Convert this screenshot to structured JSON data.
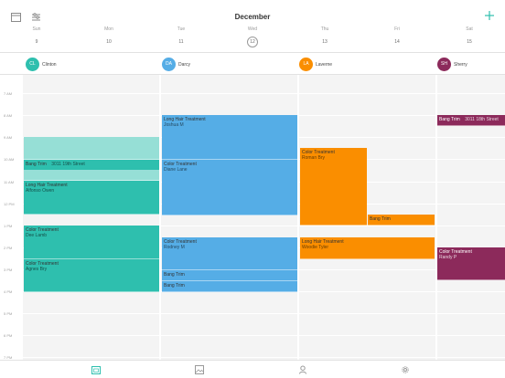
{
  "header": {
    "month": "December",
    "add_icon": "plus-icon",
    "calendar_icon": "calendar-icon",
    "filter_icon": "filter-icon"
  },
  "week": [
    {
      "name": "Sun",
      "num": "9"
    },
    {
      "name": "Mon",
      "num": "10"
    },
    {
      "name": "Tue",
      "num": "11"
    },
    {
      "name": "Wed",
      "num": "12"
    },
    {
      "name": "Thu",
      "num": "13"
    },
    {
      "name": "Fri",
      "num": "14"
    },
    {
      "name": "Sat",
      "num": "15"
    }
  ],
  "today": "12",
  "staff": [
    {
      "initials": "CL",
      "name": "Clinton",
      "color": "#2ebfae"
    },
    {
      "initials": "DA",
      "name": "Darcy",
      "color": "#55ade6"
    },
    {
      "initials": "LA",
      "name": "Laverne",
      "color": "#fa8e00"
    },
    {
      "initials": "SH",
      "name": "Sherry",
      "color": "#8c2a5b"
    }
  ],
  "times": [
    "7 AM",
    "8 AM",
    "9 AM",
    "10 AM",
    "11 AM",
    "12 PM",
    "1 PM",
    "2 PM",
    "3 PM",
    "4 PM",
    "5 PM",
    "6 PM",
    "7 PM"
  ],
  "events": {
    "clinton": [
      {
        "title": "Bang Trim",
        "sub": "3011 19th Street"
      },
      {
        "title": "Long Hair Treatment",
        "sub": "Alfonso Owen"
      },
      {
        "title": "Color Treatment",
        "sub": "Dee Lamb"
      },
      {
        "title": "Color Treatment",
        "sub": "Agnes Bry"
      }
    ],
    "darcy": [
      {
        "title": "Long Hair Treatment",
        "sub": "Joshua M"
      },
      {
        "title": "Color Treatment",
        "sub": "Diane Lane"
      },
      {
        "title": "Color Treatment",
        "sub": "Rodney M"
      },
      {
        "title": "Bang Trim",
        "sub": ""
      },
      {
        "title": "Bang Trim",
        "sub": ""
      }
    ],
    "laverne": [
      {
        "title": "Color Treatment",
        "sub": "Roman Bry"
      },
      {
        "title": "Bang Trim",
        "sub": ""
      },
      {
        "title": "Long Hair Treatment",
        "sub": "Woodie Tyler"
      }
    ],
    "sherry": [
      {
        "title": "Bang Trim",
        "sub": "3011 18th Street"
      },
      {
        "title": "Color Treatment",
        "sub": "Randy P"
      }
    ]
  },
  "tabs": [
    {
      "name": "calendar-tab",
      "icon": "calendar-icon",
      "active": true
    },
    {
      "name": "gallery-tab",
      "icon": "image-icon",
      "active": false
    },
    {
      "name": "profile-tab",
      "icon": "person-icon",
      "active": false
    },
    {
      "name": "settings-tab",
      "icon": "gear-icon",
      "active": false
    }
  ]
}
